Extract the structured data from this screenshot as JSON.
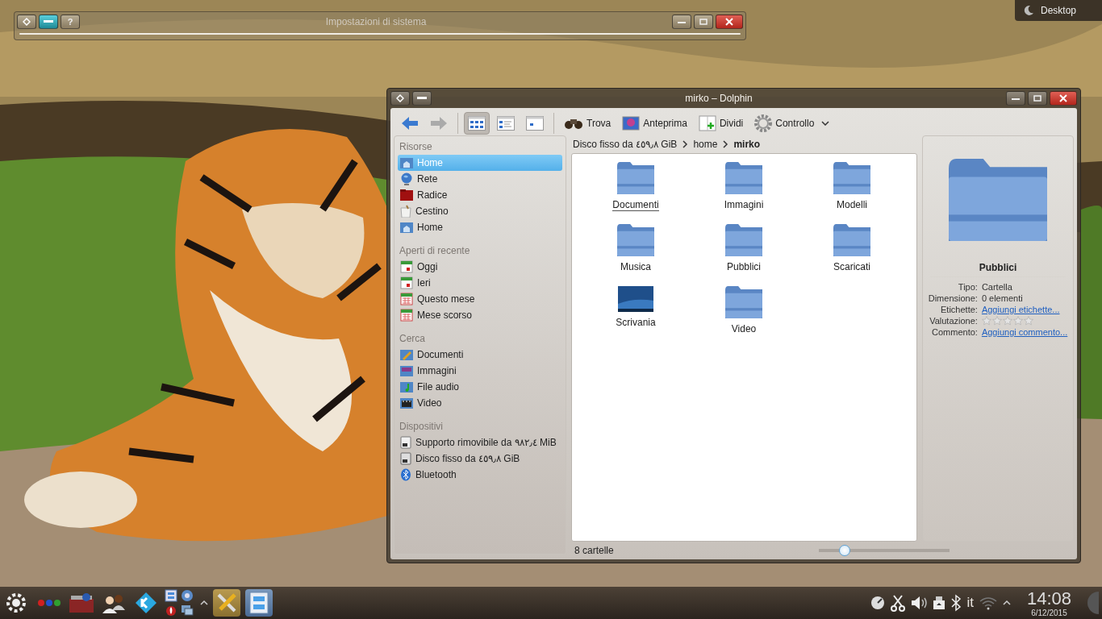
{
  "desktop_button": {
    "label": "Desktop"
  },
  "settings_window": {
    "title": "Impostazioni di sistema",
    "help": "?"
  },
  "dolphin": {
    "title": "mirko – Dolphin",
    "nav": [
      {
        "kind": "back",
        "disabled": false
      },
      {
        "kind": "forward",
        "disabled": true
      }
    ],
    "view_modes": [
      {
        "kind": "icons",
        "selected": true
      },
      {
        "kind": "compact",
        "selected": false
      },
      {
        "kind": "details",
        "selected": false
      }
    ],
    "actions": [
      {
        "label": "Trova",
        "kind": "find"
      },
      {
        "label": "Anteprima",
        "kind": "preview"
      },
      {
        "label": "Dividi",
        "kind": "split"
      },
      {
        "label": "Controllo",
        "kind": "control"
      }
    ],
    "places": [
      {
        "heading": "Risorse",
        "items": [
          {
            "label": "Home",
            "kind": "home",
            "selected": true
          },
          {
            "label": "Rete",
            "kind": "network",
            "selected": false
          },
          {
            "label": "Radice",
            "kind": "root",
            "selected": false
          },
          {
            "label": "Cestino",
            "kind": "trash",
            "selected": false
          },
          {
            "label": "Home",
            "kind": "home",
            "selected": false
          }
        ]
      },
      {
        "heading": "Aperti di recente",
        "items": [
          {
            "label": "Oggi",
            "kind": "day",
            "selected": false
          },
          {
            "label": "Ieri",
            "kind": "day",
            "selected": false
          },
          {
            "label": "Questo mese",
            "kind": "month",
            "selected": false
          },
          {
            "label": "Mese scorso",
            "kind": "month",
            "selected": false
          }
        ]
      },
      {
        "heading": "Cerca",
        "items": [
          {
            "label": "Documenti",
            "kind": "documents",
            "selected": false
          },
          {
            "label": "Immagini",
            "kind": "images",
            "selected": false
          },
          {
            "label": "File audio",
            "kind": "audio",
            "selected": false
          },
          {
            "label": "Video",
            "kind": "video",
            "selected": false
          }
        ]
      },
      {
        "heading": "Dispositivi",
        "items": [
          {
            "label": "Supporto rimovibile da ٩٨٢٫٤ MiB",
            "kind": "removable",
            "selected": false
          },
          {
            "label": "Disco fisso da ٤٥٩٫٨ GiB",
            "kind": "disk",
            "selected": false
          },
          {
            "label": "Bluetooth",
            "kind": "bluetooth",
            "selected": false
          }
        ]
      }
    ],
    "breadcrumb": [
      {
        "label": "Disco fisso da ٤٥٩٫٨ GiB",
        "current": false
      },
      {
        "label": "home",
        "current": false
      },
      {
        "label": "mirko",
        "current": true
      }
    ],
    "files": [
      {
        "label": "Documenti",
        "kind": "folder",
        "focused": true
      },
      {
        "label": "Immagini",
        "kind": "folder",
        "focused": false
      },
      {
        "label": "Modelli",
        "kind": "folder",
        "focused": false
      },
      {
        "label": "Musica",
        "kind": "folder",
        "focused": false
      },
      {
        "label": "Pubblici",
        "kind": "folder",
        "focused": false
      },
      {
        "label": "Scaricati",
        "kind": "folder",
        "focused": false
      },
      {
        "label": "Scrivania",
        "kind": "desktop",
        "focused": false
      },
      {
        "label": "Video",
        "kind": "folder",
        "focused": false
      }
    ],
    "info": {
      "title": "Pubblici",
      "rows": [
        {
          "label": "Tipo:",
          "kind": "text",
          "value": "Cartella"
        },
        {
          "label": "Dimensione:",
          "kind": "text",
          "value": "0 elementi"
        },
        {
          "label": "Etichette:",
          "kind": "link",
          "value": "Aggiungi etichette..."
        },
        {
          "label": "Valutazione:",
          "kind": "rating",
          "stars": 0
        },
        {
          "label": "Commento:",
          "kind": "link",
          "value": "Aggiungi commento..."
        }
      ]
    },
    "status": {
      "text": "8 cartelle",
      "zoom": {
        "level": 0.2
      }
    }
  },
  "taskbar": {
    "launchers": [
      {
        "kind": "kmenu"
      },
      {
        "kind": "dots"
      },
      {
        "kind": "toolbox"
      },
      {
        "kind": "users"
      },
      {
        "kind": "kodi"
      }
    ],
    "quick": [
      {
        "kind": "cabinet"
      },
      {
        "kind": "browser"
      },
      {
        "kind": "flame"
      },
      {
        "kind": "screens"
      }
    ],
    "tasks": [
      {
        "kind": "settings",
        "active": false
      },
      {
        "kind": "files",
        "active": true
      }
    ],
    "tray": [
      {
        "kind": "gauge"
      },
      {
        "kind": "scissors"
      },
      {
        "kind": "speaker"
      },
      {
        "kind": "usb"
      },
      {
        "kind": "bluetooth"
      },
      {
        "kind": "keyboard",
        "label": "it"
      },
      {
        "kind": "wifi"
      }
    ],
    "time": "14:08",
    "date": "6/12/2015"
  }
}
